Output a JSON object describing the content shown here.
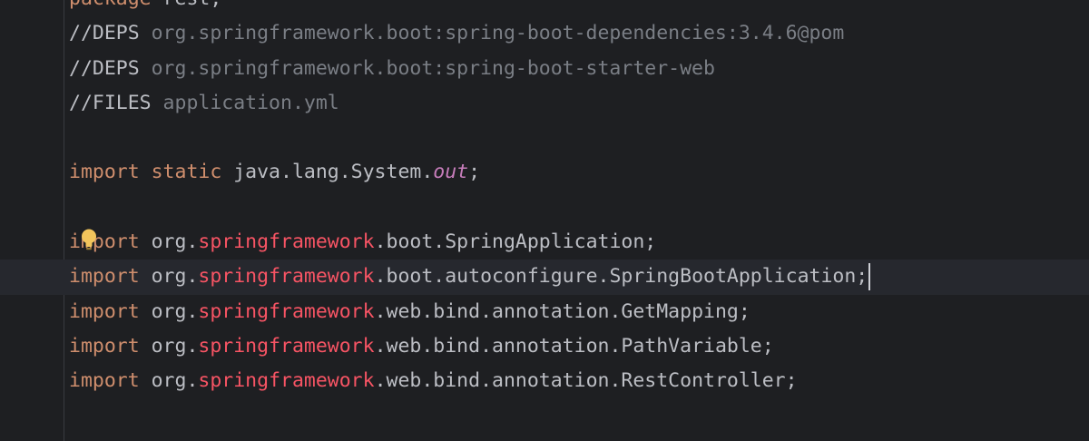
{
  "editor": {
    "lines": [
      {
        "t1": "package",
        "t2": " rest;"
      },
      {
        "tag": "//DEPS",
        "text": " org.springframework.boot:spring-boot-dependencies:3.4.6@pom"
      },
      {
        "tag": "//DEPS",
        "text": " org.springframework.boot:spring-boot-starter-web"
      },
      {
        "tag": "//FILES",
        "text": " application.yml"
      },
      {
        "kw1": "import",
        "kw2": " static",
        "p1": " java.lang.System.",
        "it": "out",
        "p2": ";"
      },
      {
        "kw": "import",
        "a": " org.",
        "pkg": "springframework",
        "b": ".boot.SpringApplication;"
      },
      {
        "kw": "import",
        "a": " org.",
        "pkg": "springframework",
        "b": ".boot.autoconfigure.SpringBootApplication;"
      },
      {
        "kw": "import",
        "a": " org.",
        "pkg": "springframework",
        "b": ".web.bind.annotation.GetMapping;"
      },
      {
        "kw": "import",
        "a": " org.",
        "pkg": "springframework",
        "b": ".web.bind.annotation.PathVariable;"
      },
      {
        "kw": "import",
        "a": " org.",
        "pkg": "springframework",
        "b": ".web.bind.annotation.RestController;"
      }
    ]
  },
  "colors": {
    "background": "#1e1f22",
    "keyword": "#cf8e6d",
    "comment": "#7a7e85",
    "package_highlight": "#f75464",
    "static_field": "#c77dbb",
    "bulb": "#f2c55c"
  }
}
